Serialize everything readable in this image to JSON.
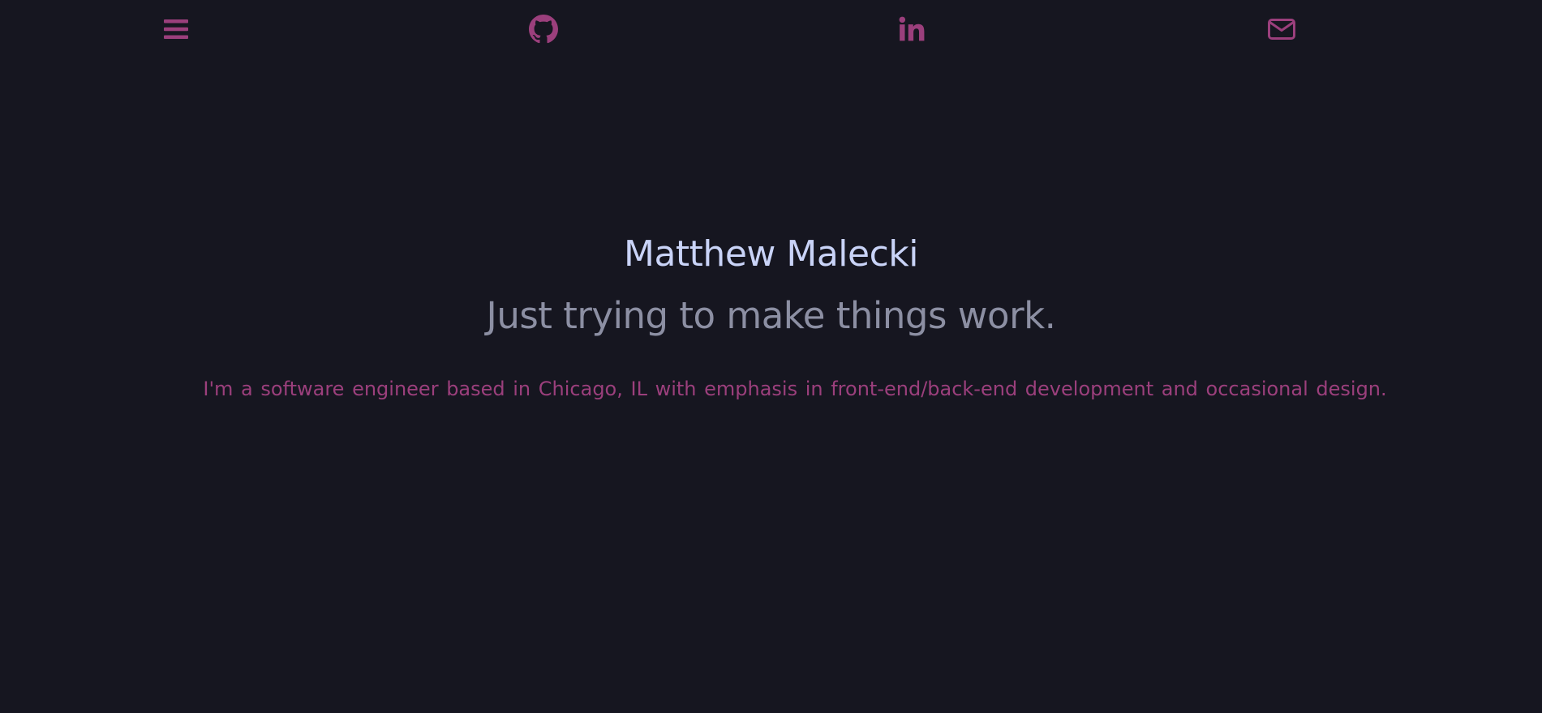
{
  "header": {
    "icons": {
      "menu": "menu-icon",
      "github": "github-icon",
      "linkedin": "linkedin-icon",
      "mail": "mail-icon"
    },
    "accent_color": "#9b3f7c"
  },
  "hero": {
    "name": "Matthew Malecki",
    "tagline": "Just trying to make things work.",
    "bio": "I'm a software engineer based in Chicago, IL with emphasis in front-end/back-end development and occasional design."
  },
  "colors": {
    "background": "#161620",
    "name": "#c9d3f7",
    "tagline": "#8c8fa3",
    "bio": "#9b3f7c"
  }
}
